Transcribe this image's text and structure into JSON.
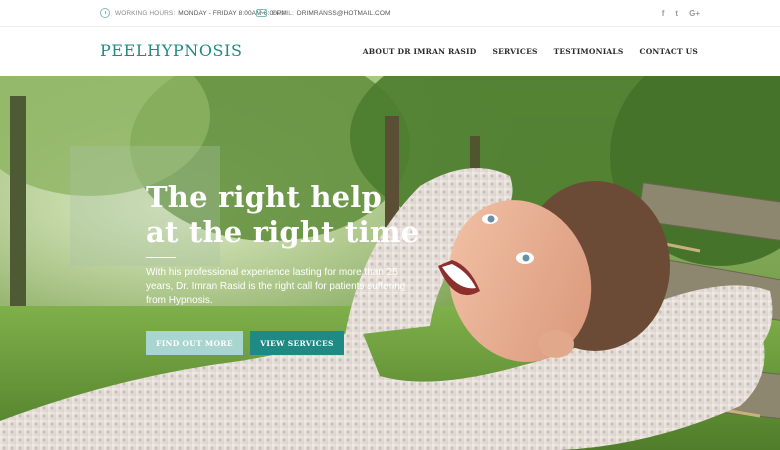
{
  "topbar": {
    "hours_label": "WORKING HOURS:",
    "hours_value": "MONDAY - FRIDAY 8:00AM-6:00PM",
    "email_label": "EMAIL:",
    "email_value": "DRIMRANSS@HOTMAIL.COM",
    "social": [
      "f",
      "t",
      "G+"
    ]
  },
  "header": {
    "logo": "PEELHYPNOSIS",
    "nav": [
      "ABOUT DR IMRAN RASID",
      "SERVICES",
      "TESTIMONIALS",
      "CONTACT US"
    ]
  },
  "hero": {
    "title_line1": "The right help",
    "title_line2": "at the right time",
    "description": "With his professional experience lasting for more than 25 years, Dr. Imran Rasid is the right call for patients suffering from Hypnosis.",
    "button_primary": "FIND OUT MORE",
    "button_secondary": "VIEW SERVICES"
  },
  "colors": {
    "brand": "#1f8a84",
    "button_light": "#a8d5d0"
  },
  "icons": {
    "hours": "clock-icon",
    "email": "mail-icon",
    "social": [
      "facebook-icon",
      "twitter-icon",
      "google-plus-icon"
    ]
  }
}
